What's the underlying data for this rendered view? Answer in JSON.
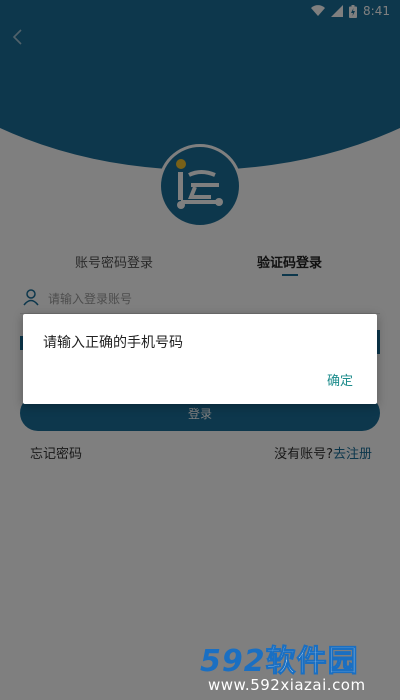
{
  "status_bar": {
    "time": "8:41"
  },
  "tabs": {
    "password_login": "账号密码登录",
    "code_login": "验证码登录"
  },
  "phone_field": {
    "placeholder": "请输入登录账号",
    "value": ""
  },
  "login_button": {
    "label": "登录"
  },
  "links": {
    "forgot_password": "忘记密码",
    "no_account": "没有账号?",
    "register": "去注册"
  },
  "dialog": {
    "message": "请输入正确的手机号码",
    "confirm": "确定"
  },
  "watermark": {
    "brand_number": "592",
    "brand_text": "软件园",
    "url": "www.592xiazai.com"
  },
  "colors": {
    "primary": "#1b6f99",
    "dialog_button": "#1d8c8c",
    "watermark": "#1a6fc2"
  }
}
